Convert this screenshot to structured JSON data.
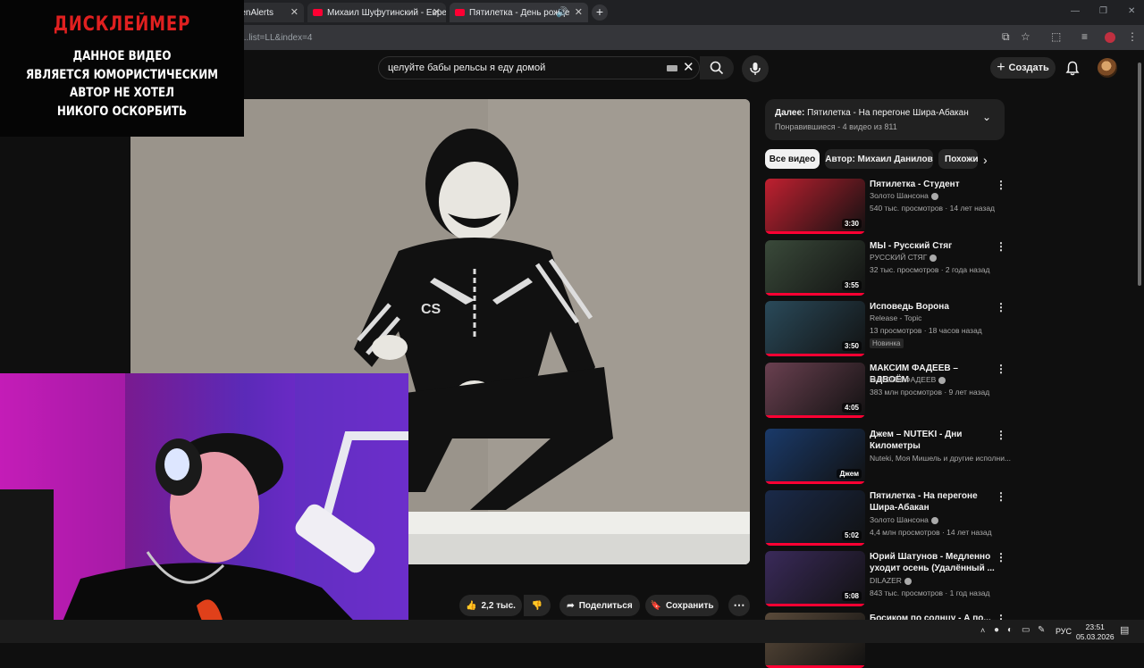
{
  "browser": {
    "tabs": [
      {
        "label": "...enAlerts"
      },
      {
        "label": "Михаил Шуфутинский - Еврей"
      },
      {
        "label": "Пятилетка - День рожден..."
      }
    ],
    "url": "...list=LL&index=4"
  },
  "disclaimer": {
    "title": "ДИСКЛЕЙМЕР",
    "lines": [
      "ДАННОЕ ВИДЕО",
      "ЯВЛЯЕТСЯ ЮМОРИСТИЧЕСКИМ",
      "АВТОР НЕ ХОТЕЛ",
      "НИКОГО ОСКОРБИТЬ"
    ]
  },
  "header": {
    "search_query": "целуйте бабы рельсы я еду домой",
    "create_label": "Создать"
  },
  "actions": {
    "likes": "2,2 тыс.",
    "share": "Поделиться",
    "save": "Сохранить"
  },
  "playlist": {
    "next_prefix": "Далее:",
    "next_title": "Пятилетка - На перегоне Шира-Абакан",
    "subtitle": "Понравившиеся - 4 видео из 811"
  },
  "chips": [
    "Все видео",
    "Автор: Михаил Данилов",
    "Похожие"
  ],
  "videos": [
    {
      "title": "Пятилетка - Студент",
      "channel": "Золото Шансона",
      "verified": true,
      "meta": "540 тыс. просмотров · 14 лет назад",
      "duration": "3:30",
      "badge": ""
    },
    {
      "title": "МЫ - Русский Стяг",
      "channel": "РУССКИЙ СТЯГ",
      "verified": true,
      "meta": "32 тыс. просмотров · 2 года назад",
      "duration": "3:55",
      "badge": ""
    },
    {
      "title": "Исповедь Ворона",
      "channel": "Release - Topic",
      "verified": false,
      "meta": "13 просмотров · 18 часов назад",
      "duration": "3:50",
      "badge": "Новинка"
    },
    {
      "title": "МАКСИМ ФАДЕЕВ – ВДВОЁМ",
      "channel": "МАКСИМ ФАДЕЕВ",
      "verified": true,
      "meta": "383 млн просмотров · 9 лет назад",
      "duration": "4:05",
      "badge": ""
    },
    {
      "title": "Джем – NUTEKI - Дни Километры",
      "channel": "Nuteki, Моя Мишель и другие исполни...",
      "verified": false,
      "meta": "",
      "duration": "Джем",
      "badge": ""
    },
    {
      "title": "Пятилетка - На перегоне Шира-Абакан",
      "channel": "Золото Шансона",
      "verified": true,
      "meta": "4,4 млн просмотров · 14 лет назад",
      "duration": "5:02",
      "badge": ""
    },
    {
      "title": "Юрий Шатунов - Медленно уходит осень (Удалённый ...",
      "channel": "DILAZER",
      "verified": true,
      "meta": "843 тыс. просмотров · 1 год назад",
      "duration": "5:08",
      "badge": ""
    },
    {
      "title": "Босиком по солнцу - А по...",
      "channel": "",
      "verified": false,
      "meta": "",
      "duration": "",
      "badge": ""
    }
  ],
  "thumb_colors": [
    "#c02030",
    "#3a4a3a",
    "#2a4a5a",
    "#6a4050",
    "#1a3a6a",
    "#1a2a4a",
    "#3a2a5a",
    "#5a4a3a"
  ],
  "taskbar": {
    "lang": "РУС",
    "time": "23:51",
    "date": "05.03.2026"
  }
}
